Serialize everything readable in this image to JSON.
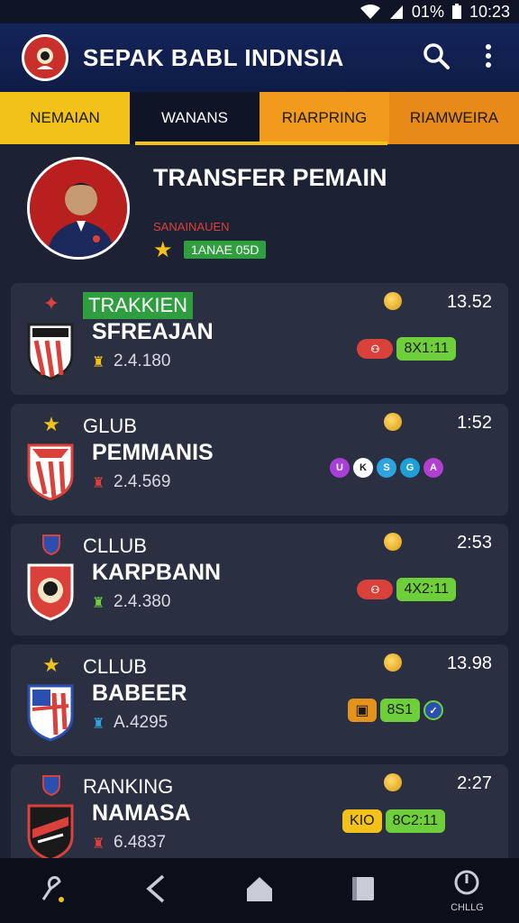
{
  "status": {
    "battery": "01%",
    "time": "10:23"
  },
  "app": {
    "title": "SEPAK BABL INDNSIA"
  },
  "tabs": [
    {
      "label": "NEMAIAN"
    },
    {
      "label": "WANANS"
    },
    {
      "label": "RIARPRING"
    },
    {
      "label": "RIAMWEIRA"
    }
  ],
  "hero": {
    "title": "TRANSFER PEMAIN",
    "subtitle": "SANAINAUEN",
    "badge": "1ANAE 05D"
  },
  "cards": [
    {
      "category": "TRAKKIEN",
      "time": "13.52",
      "team": "SFREAJAN",
      "stat": "2.4.180",
      "pills": [
        "8X1:11"
      ],
      "colors": [
        "#d9413a",
        "#6fcf3a"
      ]
    },
    {
      "category": "GLUB",
      "time": "1:52",
      "team": "PEMMANIS",
      "stat": "2.4.569",
      "pills": [
        "U",
        "K",
        "S",
        "G",
        "A"
      ],
      "colors": [
        "#a83fd9",
        "#ffffff",
        "#2fa3e0",
        "#1d9fd6",
        "#b13fcf"
      ]
    },
    {
      "category": "CLLUB",
      "time": "2:53",
      "team": "KARPBANN",
      "stat": "2.4.380",
      "pills": [
        "4X2:11"
      ],
      "colors": [
        "#d9413a",
        "#6fcf3a"
      ]
    },
    {
      "category": "CLLUB",
      "time": "13.98",
      "team": "BABEER",
      "stat": "A.4295",
      "pills": [
        "8S1"
      ],
      "colors": [
        "#e3921b",
        "#6fcf3a"
      ]
    },
    {
      "category": "RANKING",
      "time": "2:27",
      "team": "NAMASA",
      "stat": "6.4837",
      "pills": [
        "KIO",
        "8C2:11"
      ],
      "colors": [
        "#f2c21b",
        "#6fcf3a"
      ]
    }
  ],
  "nav": {
    "last_label": "CHLLG"
  }
}
